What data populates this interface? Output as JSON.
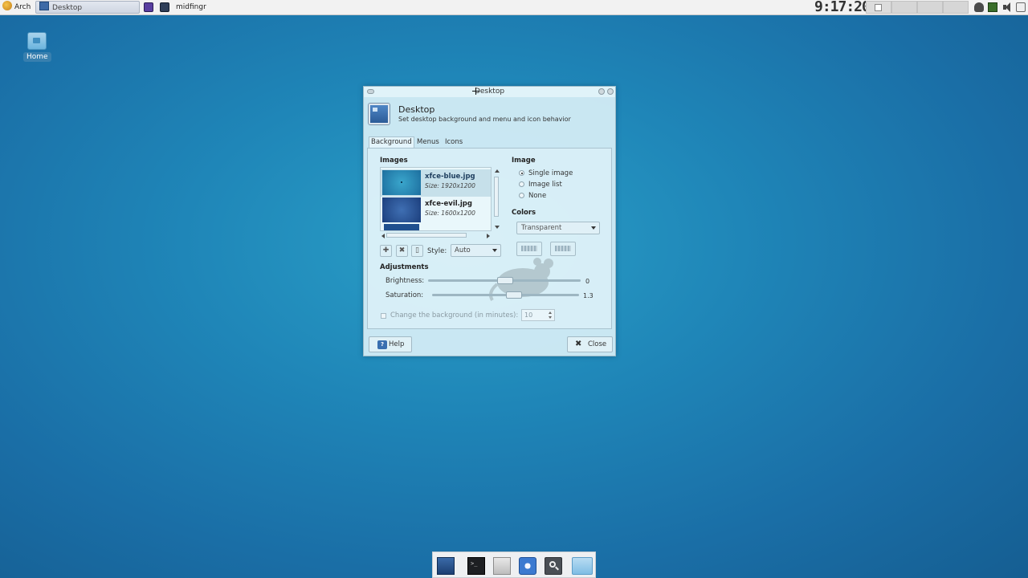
{
  "top_panel": {
    "app_menu_label": "Arch",
    "tasks": [
      {
        "label": "Desktop",
        "active": true
      },
      {
        "label": "midfingr",
        "active": false
      }
    ],
    "clock": "9:17:20",
    "workspaces": 4,
    "tray_icons": [
      "bug-icon",
      "network-icon",
      "volume-icon",
      "power-icon"
    ]
  },
  "desktop_icons": [
    {
      "label": "Home",
      "icon": "folder-icon"
    }
  ],
  "window": {
    "title": "Desktop",
    "header_title": "Desktop",
    "header_subtitle": "Set desktop background and menu and icon behavior",
    "tabs": [
      {
        "label": "Background",
        "active": true
      },
      {
        "label": "Menus",
        "active": false
      },
      {
        "label": "Icons",
        "active": false
      }
    ],
    "images_title": "Images",
    "images": [
      {
        "name": "xfce-blue.jpg",
        "size": "Size: 1920x1200",
        "selected": true
      },
      {
        "name": "xfce-evil.jpg",
        "size": "Size: 1600x1200",
        "selected": false
      }
    ],
    "style_label": "Style:",
    "style_value": "Auto",
    "image_title": "Image",
    "image_options": [
      {
        "label": "Single image",
        "selected": true
      },
      {
        "label": "Image list",
        "selected": false
      },
      {
        "label": "None",
        "selected": false
      }
    ],
    "colors_title": "Colors",
    "colors_value": "Transparent",
    "adjustments_title": "Adjustments",
    "brightness_label": "Brightness:",
    "brightness_value": "0",
    "saturation_label": "Saturation:",
    "saturation_value": "1.3",
    "change_bg_label": "Change the background (in minutes):",
    "change_bg_minutes": "10",
    "help_label": "Help",
    "close_label": "Close"
  },
  "dock": {
    "items": [
      "show-desktop-icon",
      "terminal-icon",
      "file-manager-icon",
      "web-browser-icon",
      "search-icon",
      "folder-icon"
    ]
  }
}
